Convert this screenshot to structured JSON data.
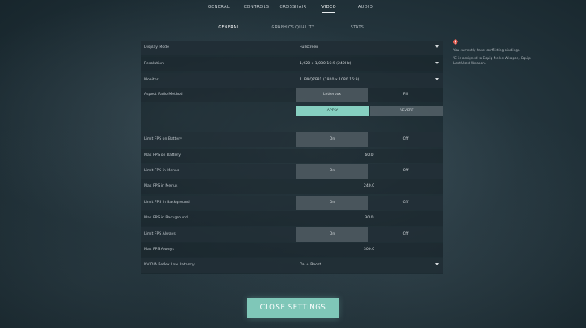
{
  "top_tabs": [
    {
      "label": "GENERAL"
    },
    {
      "label": "CONTROLS"
    },
    {
      "label": "CROSSHAIR"
    },
    {
      "label": "VIDEO"
    },
    {
      "label": "AUDIO"
    }
  ],
  "sub_tabs": [
    {
      "label": "GENERAL"
    },
    {
      "label": "GRAPHICS QUALITY"
    },
    {
      "label": "STATS"
    }
  ],
  "settings": {
    "display_mode": {
      "label": "Display Mode",
      "value": "Fullscreen"
    },
    "resolution": {
      "label": "Resolution",
      "value": "1,920 x 1,080 16:9 (240Hz)"
    },
    "monitor": {
      "label": "Monitor",
      "value": "1. BNQ7F81 (1920 x 1080 16:9)"
    },
    "aspect_ratio": {
      "label": "Aspect Ratio Method",
      "option_a": "Letterbox",
      "option_b": "Fill"
    },
    "apply_label": "APPLY",
    "revert_label": "REVERT",
    "limit_fps_battery": {
      "label": "Limit FPS on Battery",
      "on": "On",
      "off": "Off"
    },
    "max_fps_battery": {
      "label": "Max FPS on Battery",
      "value": "60.0"
    },
    "limit_fps_menus": {
      "label": "Limit FPS in Menus",
      "on": "On",
      "off": "Off"
    },
    "max_fps_menus": {
      "label": "Max FPS in Menus",
      "value": "240.0"
    },
    "limit_fps_background": {
      "label": "Limit FPS in Background",
      "on": "On",
      "off": "Off"
    },
    "max_fps_background": {
      "label": "Max FPS in Background",
      "value": "30.0"
    },
    "limit_fps_always": {
      "label": "Limit FPS Always",
      "on": "On",
      "off": "Off"
    },
    "max_fps_always": {
      "label": "Max FPS Always",
      "value": "300.0"
    },
    "nvidia_reflex": {
      "label": "NVIDIA Reflex Low Latency",
      "value": "On + Boost"
    }
  },
  "note": {
    "icon": "warning-diamond-icon",
    "line1": "You currently have conflicting bindings.",
    "line2": "'E' is assigned to Equip Melee Weapon, Equip",
    "line3": "Last Used Weapon."
  },
  "close_label": "CLOSE SETTINGS",
  "colors": {
    "accent": "#86cfc0",
    "warning": "#e05a4f"
  }
}
